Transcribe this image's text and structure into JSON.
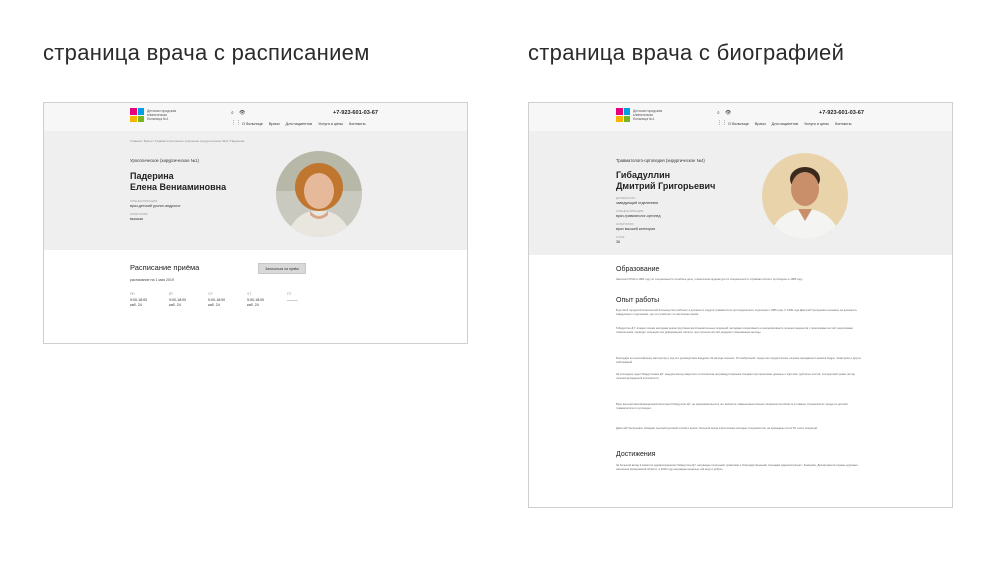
{
  "headings": {
    "left": "страница врача с расписанием",
    "right": "страница врача с биографией"
  },
  "site": {
    "logo_text": "Детская городская клиническая больница №1",
    "phone": "+7-923-601-03-67",
    "menu": [
      "О больнице",
      "Врачи",
      "Для пациентов",
      "Услуги и цены",
      "Контакты"
    ]
  },
  "left_page": {
    "breadcrumbs": "Главная  /  Врачи  /  Травматологическое отделение (хирургическое №4)  /  Падерина",
    "department": "Урологическое (хирургическое №1)",
    "name_line1": "Падерина",
    "name_line2": "Елена Вениаминовна",
    "spec_label": "СПЕЦИАЛИЗАЦИЯ",
    "spec_value": "врач-детский уролог-андролог",
    "cat_label": "КАТЕГОРИЯ",
    "cat_value": "высшая",
    "schedule": {
      "title": "Расписание приёма",
      "button": "Записаться на приём",
      "subtitle": "расписание на 1 мая 2019",
      "days": [
        {
          "day": "ПН",
          "time": "9:00-18:00",
          "room": "каб. 24"
        },
        {
          "day": "ВТ",
          "time": "9:00-18:00",
          "room": "каб. 24"
        },
        {
          "day": "СР",
          "time": "9:00-18:00",
          "room": "каб. 24"
        },
        {
          "day": "ЧТ",
          "time": "9:00-18:00",
          "room": "каб. 24"
        },
        {
          "day": "ПТ",
          "time": "———",
          "room": ""
        }
      ]
    }
  },
  "right_page": {
    "department": "Травматолого-ортопедия (хирургическое №4)",
    "name_line1": "Гибадуллин",
    "name_line2": "Дмитрий Григорьевич",
    "pos_label": "ДОЛЖНОСТЬ",
    "pos_value": "заведующий отделением",
    "spec_label": "СПЕЦИАЛИЗАЦИЯ",
    "spec_value": "врач-травматолог-ортопед",
    "cat_label": "КАТЕГОРИЯ",
    "cat_value": "врач высшей категории",
    "exp_label": "СТАЖ",
    "exp_value": "36",
    "sections": [
      {
        "title": "Образование",
        "paragraphs": [
          "Закончил КГМА в 1984 году по специальности лечебное дело, клиническая ординатура по специальности «Травматология и ортопедия» в 1986 году."
        ]
      },
      {
        "title": "Опыт работы",
        "paragraphs": [
          "В детской городской клинической больнице №1 работает в должности хирурга травматолого-ортопедического отделения с 1985 года. С 1995 года Дмитрий Григорьевич назначен на должность заведующего отделением, где он и работает по настоящее время.",
          "Гибадуллин Д.Г. владеет всеми методами реконструктивно-восстановительных операций, методами оперативного и консервативного лечения пациентов с переломами костей, переломами позвоночника, проводит операции при деформациях скелета, при опухолях костей, внедряет современные методы.",
          "Благодаря его высочайшему мастерству и под его руководством внедрено 34 метода лечения, 15 изобретений. Среди них хирургическое лечение врождённого вывиха бедра, гонартроза и других заболеваний.",
          "За последние годы Гибадуллиным Д.Г. внедрен метод закрытого остеосинтеза интрамедуллярными спицами при переломах длинных и коротких трубчатых костей, последствий травм, метод лечения врожденной косолапости.",
          "Врач высшей квалификационной категории Гибадуллин Д.Г. не прерывная высота лет является главным внештатным специалистом области в главных специалистах города по детской травматологии и ортопедии.",
          "Дмитрий Григорьевич обладает высокой деловой этикой и вносит большой вклад в воспитание молодых специалистов, на проведены почти 52 тысяч операций."
        ]
      },
      {
        "title": "Достижения",
        "paragraphs": [
          "За большой вклад в развитие здравоохранения Гибадуллин Д.Г. награжден почетными грамотами и благодарственными письмами Администрации г. Кемерово, Департамента охраны здоровья населения Кемеровской области, в 2009 году награжден медалью «За веру и добро»."
        ]
      }
    ]
  },
  "colors": {
    "hero_bg": "#efefef",
    "topbar_bg": "#f7f7f7",
    "logo": [
      "#e6007e",
      "#00a0e3",
      "#f7b500",
      "#7ab51d"
    ]
  }
}
